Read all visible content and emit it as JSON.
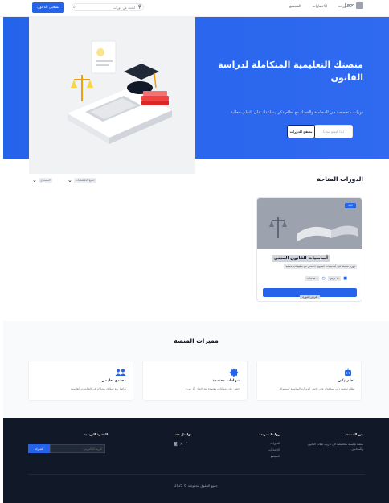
{
  "header": {
    "logo_alt": "Logo",
    "logo_text": "لوجو المنصة",
    "nav": [
      "الرئيسية",
      "الدورات",
      "الاختبارات",
      "المجتمع"
    ],
    "nav_visible": [
      "الدورات",
      "الاختبارات",
      "المجتمع"
    ],
    "search_placeholder": "ابحث عن دورات",
    "login_label": "تسجيل الدخول"
  },
  "hero": {
    "title": "منصتك التعليمية المتكاملة لدراسة القانون",
    "subtitle": "دورات متخصصة في المحاماة والقضاء مع نظام ذكي يساعدك على التعلم بفعالية",
    "primary_btn": "تصفح الدورات",
    "secondary_btn": "ابدأ التعلم مجاناً"
  },
  "courses": {
    "title": "الدورات المتاحة",
    "filters": [
      "جميع التخصصات",
      "المستوى"
    ],
    "items": [
      {
        "badge": "جديد",
        "name": "أساسيات القانون المدني",
        "desc": "دورة شاملة في أساسيات القانون المدني مع تطبيقات عملية",
        "meta": [
          "٤ ساعات",
          "٢٠ درس"
        ],
        "cta": "عرض الدورة"
      }
    ]
  },
  "features": {
    "title": "مميزات المنصة",
    "items": [
      {
        "icon": "robot-icon",
        "title": "تعلم ذكي",
        "desc": "نظام توصية ذكي يساعدك على اختيار الدورات المناسبة لمستواك"
      },
      {
        "icon": "certificate-icon",
        "title": "شهادات معتمدة",
        "desc": "احصل على شهادات معتمدة بعد اجتياز كل دورة"
      },
      {
        "icon": "users-icon",
        "title": "مجتمع تعليمي",
        "desc": "تواصل مع زملائك وشارك في النقاشات القانونية"
      }
    ]
  },
  "footer": {
    "about_title": "عن المنصة",
    "about_text": "منصة تعليمية متخصصة في تدريب طلاب القانون والمحامين",
    "links_title": "روابط سريعة",
    "links": [
      "الدورات",
      "الاختبارات",
      "المجتمع"
    ],
    "contact_title": "تواصل معنا",
    "newsletter_title": "النشرة البريدية",
    "email_placeholder": "البريد الإلكتروني",
    "subscribe_label": "اشترك",
    "copyright": "جميع الحقوق محفوظة © 2025"
  },
  "colors": {
    "primary": "#2563eb",
    "footer_bg": "#111827"
  }
}
